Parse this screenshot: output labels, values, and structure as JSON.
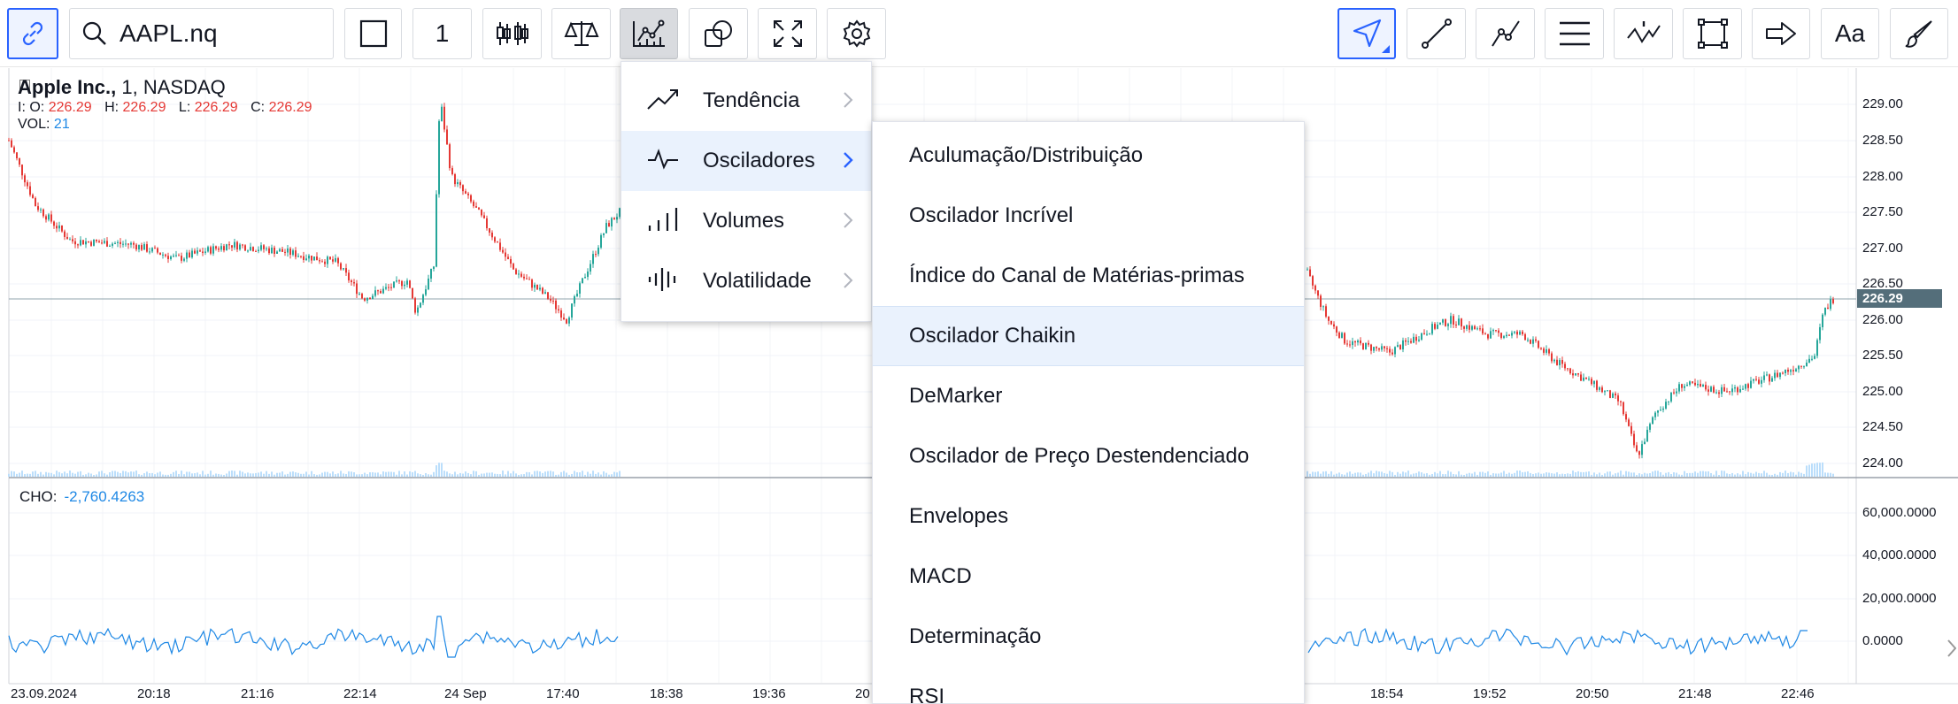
{
  "toolbar": {
    "symbol": "AAPL.nq",
    "interval": "1",
    "font_label": "Aa"
  },
  "legend": {
    "name": "Apple Inc.,",
    "interval": "1,",
    "exchange": "NASDAQ",
    "ohlc": [
      {
        "key": "I: O:",
        "value": "226.29"
      },
      {
        "key": "H:",
        "value": "226.29"
      },
      {
        "key": "L:",
        "value": "226.29"
      },
      {
        "key": "C:",
        "value": "226.29"
      }
    ],
    "vol_label": "VOL:",
    "vol_value": "21"
  },
  "oscillator": {
    "label": "CHO:",
    "value": "-2,760.4263"
  },
  "price_axis": {
    "labels": [
      "229.00",
      "228.50",
      "228.00",
      "227.50",
      "227.00",
      "226.50",
      "226.00",
      "225.50",
      "225.00",
      "224.50",
      "224.00"
    ],
    "last_price": "226.29"
  },
  "osc_axis": {
    "labels": [
      "60,000.0000",
      "40,000.0000",
      "20,000.0000",
      "0.0000"
    ]
  },
  "time_axis": {
    "labels": [
      "23.09.2024",
      "20:18",
      "21:16",
      "22:14",
      "24 Sep",
      "17:40",
      "18:38",
      "19:36",
      "20",
      "18:54",
      "19:52",
      "20:50",
      "21:48",
      "22:46"
    ]
  },
  "menu_categories": [
    {
      "label": "Tendência",
      "icon": "trend-icon"
    },
    {
      "label": "Osciladores",
      "icon": "oscillator-icon",
      "highlighted": true
    },
    {
      "label": "Volumes",
      "icon": "volume-icon"
    },
    {
      "label": "Volatilidade",
      "icon": "volatility-icon"
    }
  ],
  "submenu_items": [
    "Aculumação/Distribuição",
    "Oscilador Incrível",
    "Índice do Canal de Matérias-primas",
    "Oscilador Chaikin",
    "DeMarker",
    "Oscilador de Preço Destendenciado",
    "Envelopes",
    "MACD",
    "Determinação",
    "RSI"
  ],
  "submenu_highlighted": "Oscilador Chaikin",
  "colors": {
    "accent": "#2962ff",
    "up_candle": "#26a69a",
    "down_candle": "#e53935",
    "oscillator_line": "#1e88e5",
    "highlight_bg": "#eaf2fd",
    "last_price_bg": "#546e7a"
  }
}
